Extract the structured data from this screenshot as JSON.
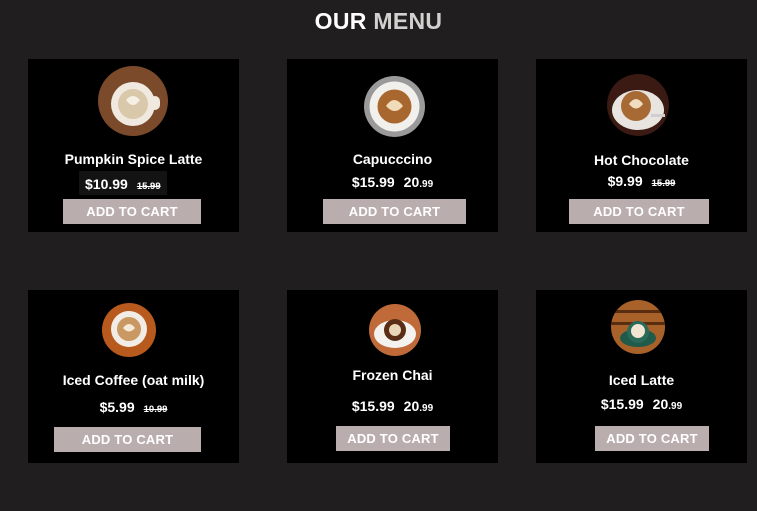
{
  "header": {
    "title_part1": "OUR",
    "title_part2": "MENU"
  },
  "items": [
    {
      "name": "Pumpkin Spice Latte",
      "price": "$10.99",
      "old_price": "15.99",
      "button": "ADD TO CART"
    },
    {
      "name": "Capucccino",
      "price": "$15.99",
      "alt_price_int": "20",
      "alt_price_dec": ".99",
      "button": "ADD TO CART"
    },
    {
      "name": "Hot Chocolate",
      "price": "$9.99",
      "old_price": "15.99",
      "button": "ADD TO CART"
    },
    {
      "name": "Iced Coffee (oat milk)",
      "price": "$5.99",
      "old_price": "10.99",
      "button": "ADD TO CART"
    },
    {
      "name": "Frozen Chai",
      "price": "$15.99",
      "alt_price_int": "20",
      "alt_price_dec": ".99",
      "button": "ADD TO CART"
    },
    {
      "name": "Iced Latte",
      "price": "$15.99",
      "alt_price_int": "20",
      "alt_price_dec": ".99",
      "button": "ADD TO CART"
    }
  ],
  "colors": {
    "page_bg": "#201e1f",
    "card_bg": "#000000",
    "button_bg": "#baadae",
    "text": "#ffffff"
  }
}
